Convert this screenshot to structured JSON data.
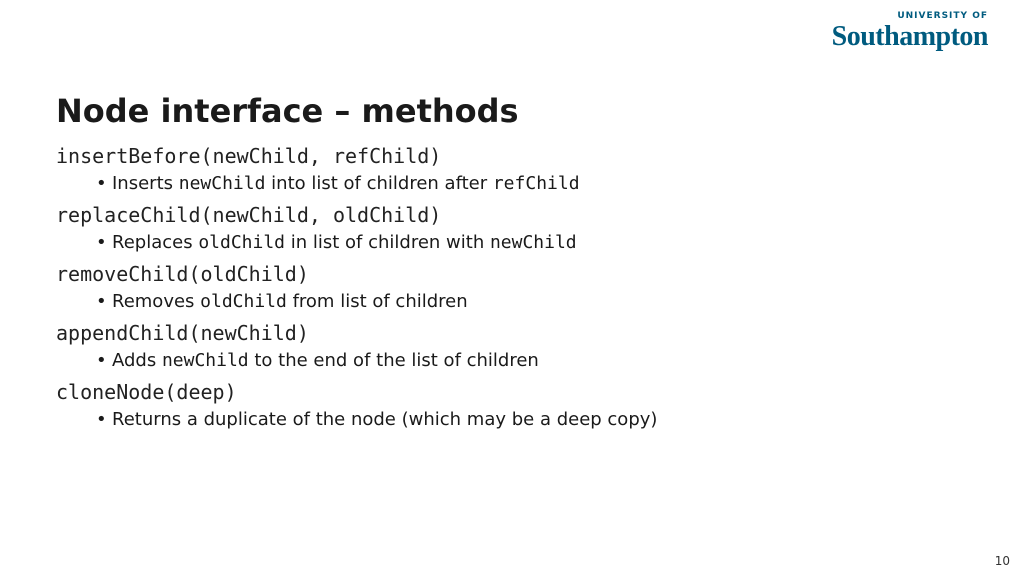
{
  "logo": {
    "tag": "UNIVERSITY OF",
    "word": "Southampton"
  },
  "title": "Node interface – methods",
  "methods": [
    {
      "signature": "insertBefore(newChild, refChild)",
      "desc_parts": [
        "Inserts ",
        "newChild",
        " into list of children after ",
        "refChild",
        ""
      ]
    },
    {
      "signature": "replaceChild(newChild, oldChild)",
      "desc_parts": [
        "Replaces ",
        "oldChild",
        " in list of children with ",
        "newChild",
        ""
      ]
    },
    {
      "signature": "removeChild(oldChild)",
      "desc_parts": [
        "Removes ",
        "oldChild",
        " from list of children",
        "",
        ""
      ]
    },
    {
      "signature": "appendChild(newChild)",
      "desc_parts": [
        "Adds ",
        "newChild",
        " to the end of the list of children",
        "",
        ""
      ]
    },
    {
      "signature": "cloneNode(deep)",
      "desc_parts": [
        "Returns a duplicate of the node (which may be a deep copy)",
        "",
        "",
        "",
        ""
      ]
    }
  ],
  "bullet": "•",
  "page_number": "10"
}
